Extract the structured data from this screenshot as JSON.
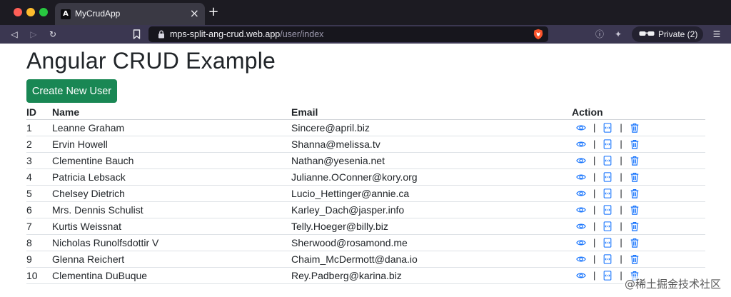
{
  "browser": {
    "tab_title": "MyCrudApp",
    "tab_favicon_letter": "A",
    "url_host": "mps-split-ang-crud.web.app",
    "url_path": "/user/index",
    "private_label": "Private (2)"
  },
  "page": {
    "title": "Angular CRUD Example",
    "create_button": "Create New User",
    "table": {
      "headers": {
        "id": "ID",
        "name": "Name",
        "email": "Email",
        "action": "Action"
      },
      "separator": "|",
      "rows": [
        {
          "id": "1",
          "name": "Leanne Graham",
          "email": "Sincere@april.biz"
        },
        {
          "id": "2",
          "name": "Ervin Howell",
          "email": "Shanna@melissa.tv"
        },
        {
          "id": "3",
          "name": "Clementine Bauch",
          "email": "Nathan@yesenia.net"
        },
        {
          "id": "4",
          "name": "Patricia Lebsack",
          "email": "Julianne.OConner@kory.org"
        },
        {
          "id": "5",
          "name": "Chelsey Dietrich",
          "email": "Lucio_Hettinger@annie.ca"
        },
        {
          "id": "6",
          "name": "Mrs. Dennis Schulist",
          "email": "Karley_Dach@jasper.info"
        },
        {
          "id": "7",
          "name": "Kurtis Weissnat",
          "email": "Telly.Hoeger@billy.biz"
        },
        {
          "id": "8",
          "name": "Nicholas Runolfsdottir V",
          "email": "Sherwood@rosamond.me"
        },
        {
          "id": "9",
          "name": "Glenna Reichert",
          "email": "Chaim_McDermott@dana.io"
        },
        {
          "id": "10",
          "name": "Clementina DuBuque",
          "email": "Rey.Padberg@karina.biz"
        }
      ]
    }
  },
  "watermark": "@稀土掘金技术社区",
  "colors": {
    "primary_button": "#198754",
    "action_icon": "#0d6efd",
    "titlebar": "#1c1b22",
    "toolbar": "#3b3751"
  },
  "icons": {
    "view": "eye-icon",
    "edit": "edit-icon",
    "delete": "trash-icon"
  }
}
